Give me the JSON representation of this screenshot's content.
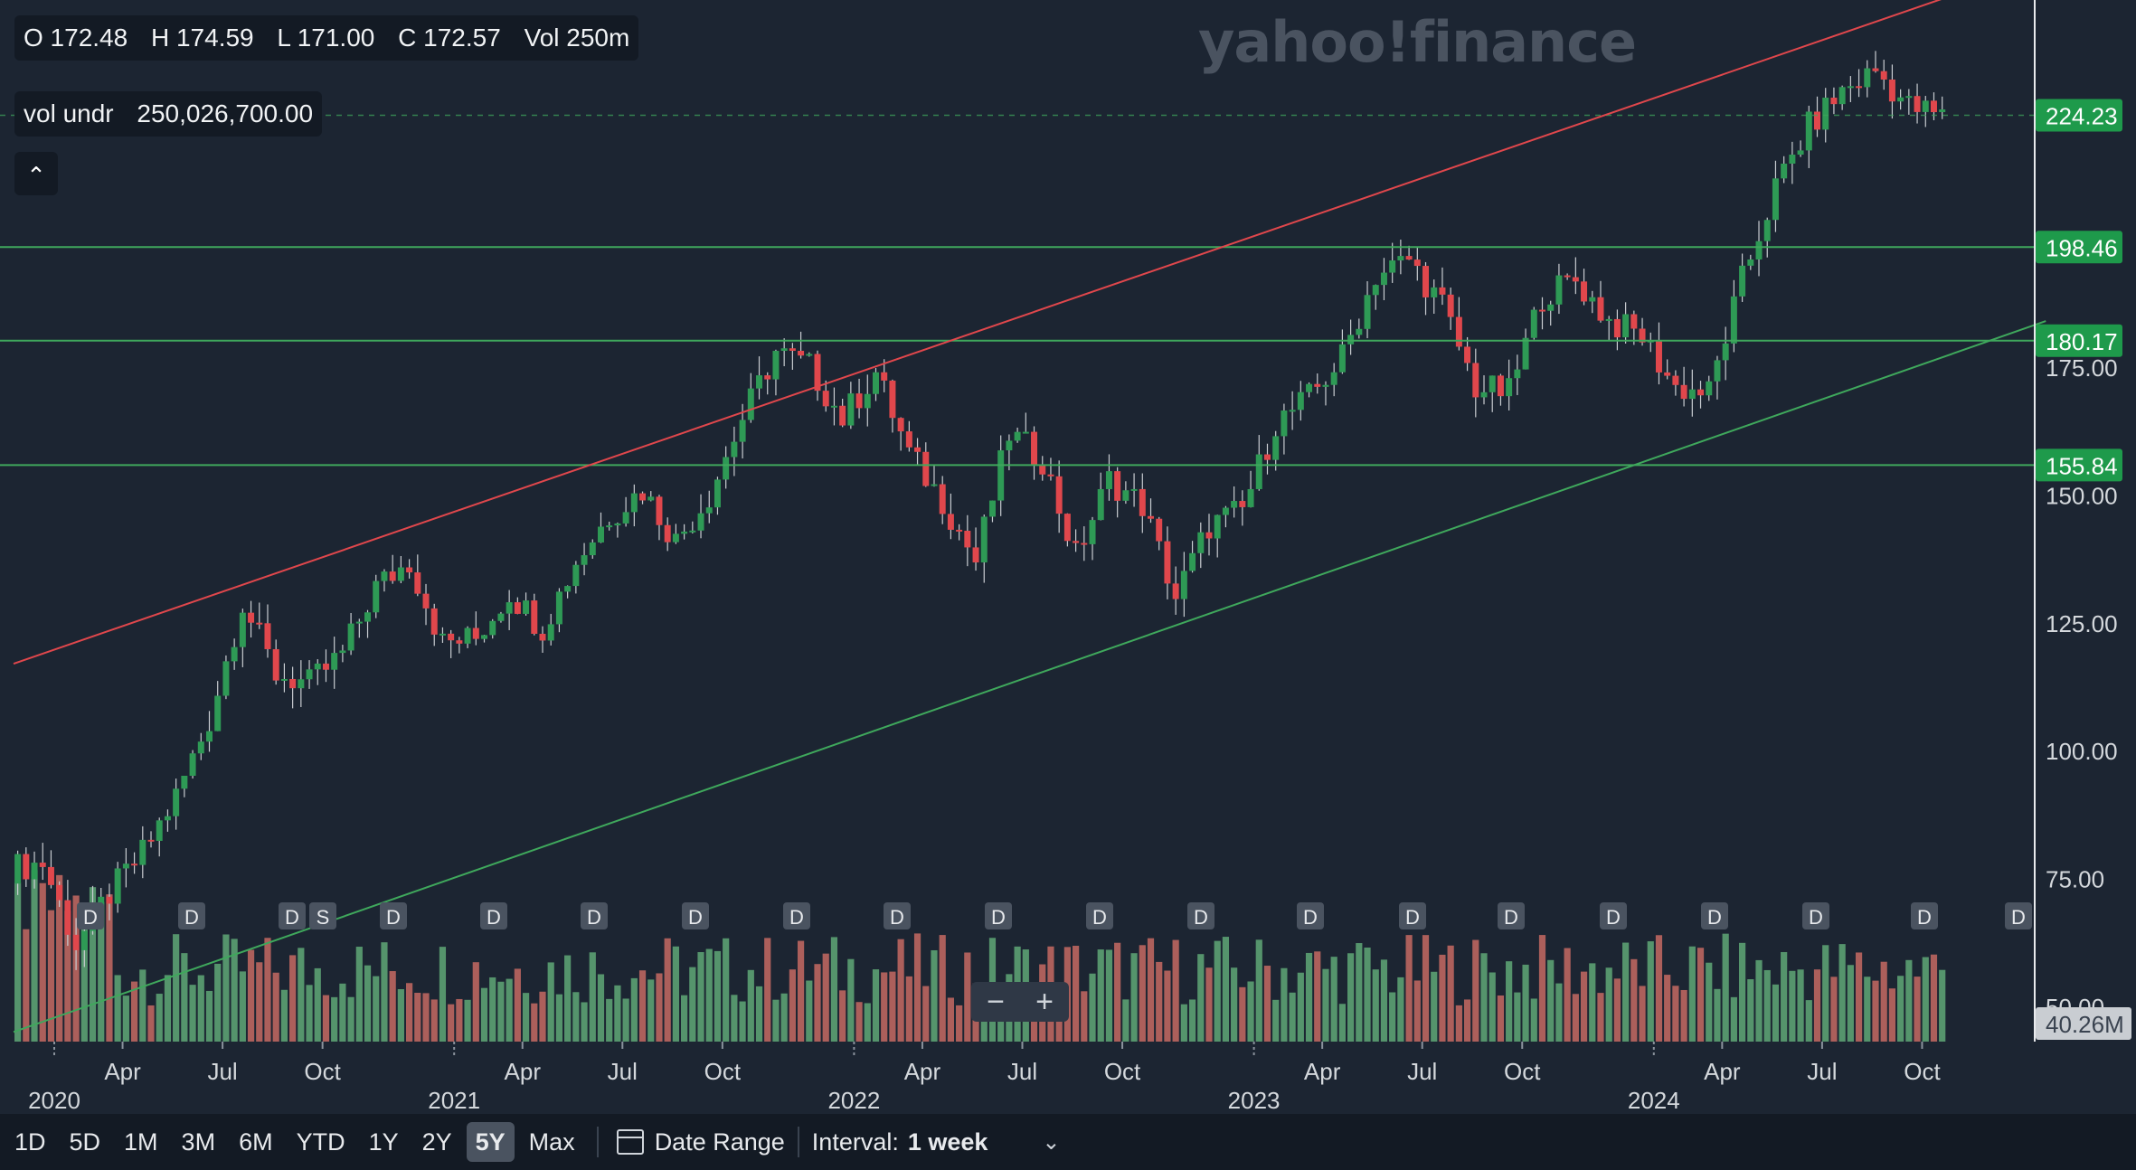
{
  "ohlc": {
    "open": "O 172.48",
    "high": "H 174.59",
    "low": "L 171.00",
    "close": "C 172.57",
    "vol": "Vol 250m"
  },
  "volume_readout": {
    "label": "vol undr",
    "value": "250,026,700.00"
  },
  "watermark": "yahoo!finance",
  "price_axis_labels": [
    "175.00",
    "150.00",
    "125.00",
    "100.00",
    "75.00",
    "50.00"
  ],
  "price_tags": [
    {
      "value": "224.23",
      "color": "#1e9a4b"
    },
    {
      "value": "198.46",
      "color": "#1e9a4b"
    },
    {
      "value": "180.17",
      "color": "#1e9a4b"
    },
    {
      "value": "155.84",
      "color": "#1e9a4b"
    }
  ],
  "volume_tag": "40.26M",
  "dividend_markers": [
    "D",
    "D",
    "D",
    "S",
    "D",
    "D",
    "D",
    "D",
    "D",
    "D",
    "D",
    "D",
    "D",
    "D",
    "D",
    "D",
    "D",
    "D",
    "D",
    "D",
    "D"
  ],
  "zoom": {
    "minus": "−",
    "plus": "+"
  },
  "toolbar": {
    "ranges": [
      "1D",
      "5D",
      "1M",
      "3M",
      "6M",
      "YTD",
      "1Y",
      "2Y",
      "5Y",
      "Max"
    ],
    "active_range": "5Y",
    "date_range_label": "Date Range",
    "interval_label": "Interval:",
    "interval_value": "1 week"
  },
  "colors": {
    "up": "#2e9a55",
    "down": "#e0474c",
    "trend_upper": "#e0474c",
    "trend_lower": "#3fa85c",
    "level": "#3fa85c",
    "background": "#1c2532"
  },
  "chart_data": {
    "type": "candlestick",
    "interval": "1 week",
    "x_ticks": [
      {
        "label": "Apr",
        "date": "2020-04"
      },
      {
        "label": "Jul",
        "date": "2020-07"
      },
      {
        "label": "Oct",
        "date": "2020-10"
      },
      {
        "label": "Apr",
        "date": "2021-04"
      },
      {
        "label": "Jul",
        "date": "2021-07"
      },
      {
        "label": "Oct",
        "date": "2021-10"
      },
      {
        "label": "Apr",
        "date": "2022-04"
      },
      {
        "label": "Jul",
        "date": "2022-07"
      },
      {
        "label": "Oct",
        "date": "2022-10"
      },
      {
        "label": "Apr",
        "date": "2023-04"
      },
      {
        "label": "Jul",
        "date": "2023-07"
      },
      {
        "label": "Oct",
        "date": "2023-10"
      },
      {
        "label": "Apr",
        "date": "2024-04"
      },
      {
        "label": "Jul",
        "date": "2024-07"
      },
      {
        "label": "Oct",
        "date": "2024-10"
      }
    ],
    "year_labels": [
      {
        "label": "2020",
        "date": "2020-01"
      },
      {
        "label": "2021",
        "date": "2021-01"
      },
      {
        "label": "2022",
        "date": "2022-01"
      },
      {
        "label": "2023",
        "date": "2023-01"
      },
      {
        "label": "2024",
        "date": "2024-01"
      }
    ],
    "y_range": [
      45,
      250
    ],
    "close_series": [
      {
        "date": "2020-01",
        "close": 77
      },
      {
        "date": "2020-02",
        "close": 78
      },
      {
        "date": "2020-03",
        "close": 62
      },
      {
        "date": "2020-04",
        "close": 72
      },
      {
        "date": "2020-05",
        "close": 80
      },
      {
        "date": "2020-06",
        "close": 91
      },
      {
        "date": "2020-07",
        "close": 106
      },
      {
        "date": "2020-08",
        "close": 129
      },
      {
        "date": "2020-09",
        "close": 115
      },
      {
        "date": "2020-10",
        "close": 113
      },
      {
        "date": "2020-11",
        "close": 119
      },
      {
        "date": "2020-12",
        "close": 132
      },
      {
        "date": "2021-01",
        "close": 137
      },
      {
        "date": "2021-02",
        "close": 121
      },
      {
        "date": "2021-03",
        "close": 122
      },
      {
        "date": "2021-04",
        "close": 131
      },
      {
        "date": "2021-05",
        "close": 124
      },
      {
        "date": "2021-06",
        "close": 137
      },
      {
        "date": "2021-07",
        "close": 146
      },
      {
        "date": "2021-08",
        "close": 151
      },
      {
        "date": "2021-09",
        "close": 141
      },
      {
        "date": "2021-10",
        "close": 150
      },
      {
        "date": "2021-11",
        "close": 165
      },
      {
        "date": "2021-12",
        "close": 178
      },
      {
        "date": "2022-01",
        "close": 175
      },
      {
        "date": "2022-02",
        "close": 165
      },
      {
        "date": "2022-03",
        "close": 174
      },
      {
        "date": "2022-04",
        "close": 158
      },
      {
        "date": "2022-05",
        "close": 149
      },
      {
        "date": "2022-06",
        "close": 137
      },
      {
        "date": "2022-07",
        "close": 162
      },
      {
        "date": "2022-08",
        "close": 157
      },
      {
        "date": "2022-09",
        "close": 138
      },
      {
        "date": "2022-10",
        "close": 153
      },
      {
        "date": "2022-11",
        "close": 148
      },
      {
        "date": "2022-12",
        "close": 130
      },
      {
        "date": "2023-01",
        "close": 144
      },
      {
        "date": "2023-02",
        "close": 147
      },
      {
        "date": "2023-03",
        "close": 164
      },
      {
        "date": "2023-04",
        "close": 169
      },
      {
        "date": "2023-05",
        "close": 177
      },
      {
        "date": "2023-06",
        "close": 193
      },
      {
        "date": "2023-07",
        "close": 196
      },
      {
        "date": "2023-08",
        "close": 187
      },
      {
        "date": "2023-09",
        "close": 171
      },
      {
        "date": "2023-10",
        "close": 170
      },
      {
        "date": "2023-11",
        "close": 189
      },
      {
        "date": "2023-12",
        "close": 192
      },
      {
        "date": "2024-01",
        "close": 184
      },
      {
        "date": "2024-02",
        "close": 181
      },
      {
        "date": "2024-03",
        "close": 171
      },
      {
        "date": "2024-04",
        "close": 170
      },
      {
        "date": "2024-05",
        "close": 192
      },
      {
        "date": "2024-06",
        "close": 210
      },
      {
        "date": "2024-07",
        "close": 222
      },
      {
        "date": "2024-08",
        "close": 229
      },
      {
        "date": "2024-09",
        "close": 233
      },
      {
        "date": "2024-10",
        "close": 226
      },
      {
        "date": "2024-11",
        "close": 224
      }
    ],
    "horizontal_levels": [
      198.46,
      180.17,
      155.84
    ],
    "current_price_line": 224.23,
    "trendlines": [
      {
        "name": "",
        "start": {
          "date": "2020-01",
          "value": 117
        },
        "end": {
          "date": "2024-11",
          "value": 249
        }
      },
      {
        "name": "",
        "start": {
          "date": "2020-01",
          "value": 45
        },
        "end": {
          "date": "2024-11",
          "value": 179
        }
      }
    ],
    "volume_axis_tag": "40.26M"
  }
}
